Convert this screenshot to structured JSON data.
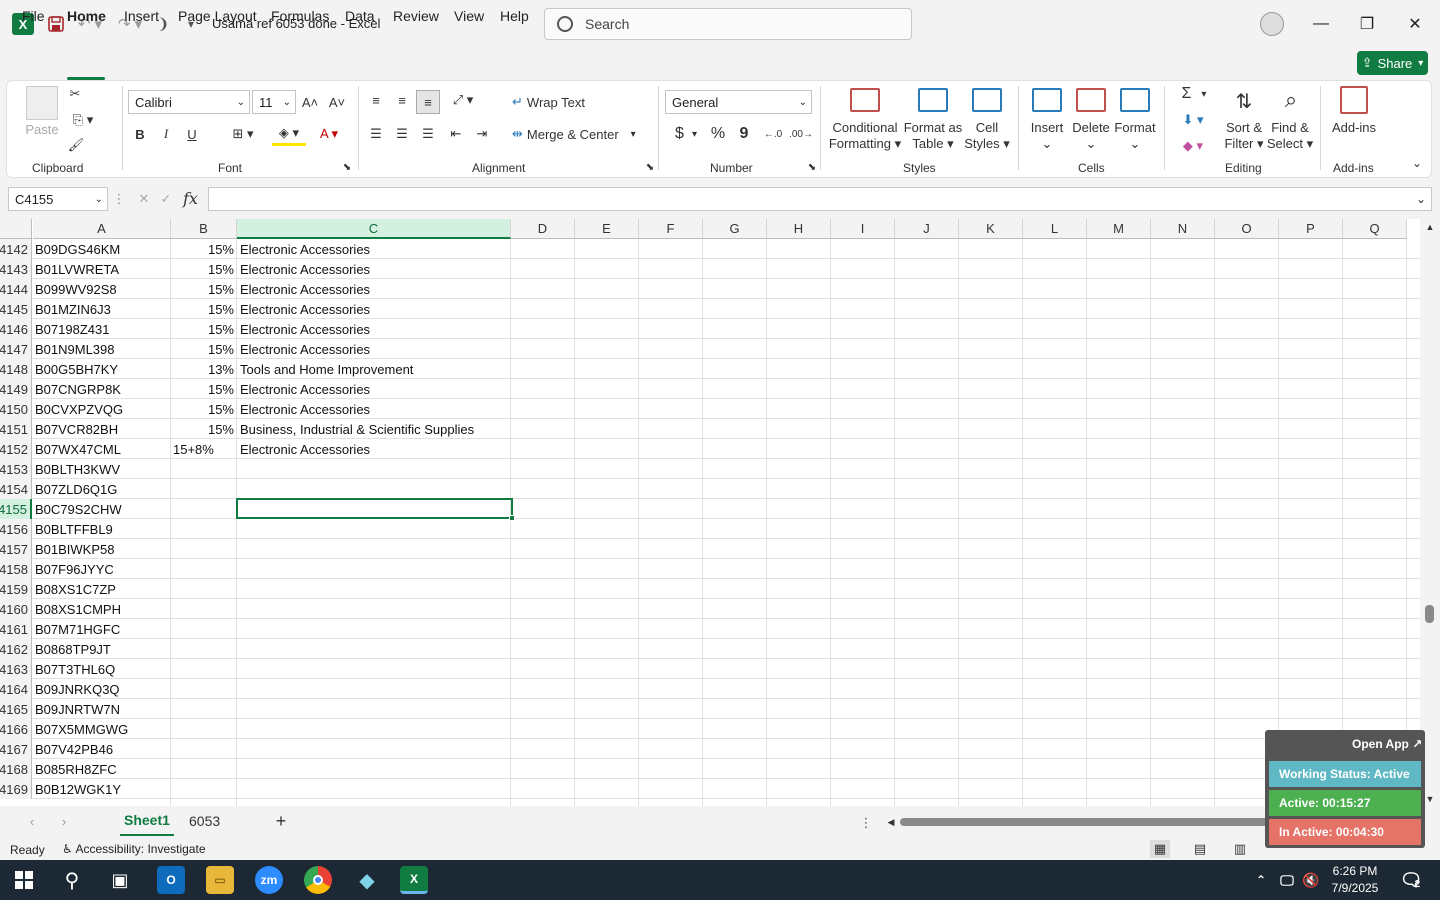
{
  "titlebar": {
    "doc_title": "Usama ref 6053 done  -  Excel",
    "search_placeholder": "Search"
  },
  "menu": [
    "File",
    "Home",
    "Insert",
    "Page Layout",
    "Formulas",
    "Data",
    "Review",
    "View",
    "Help"
  ],
  "share_label": "Share",
  "ribbon": {
    "paste_label": "Paste",
    "font_name": "Calibri",
    "font_size": "11",
    "wrap_text": "Wrap Text",
    "merge_center": "Merge & Center",
    "number_format": "General",
    "conditional_formatting": [
      "Conditional",
      "Formatting"
    ],
    "format_as_table": [
      "Format as",
      "Table"
    ],
    "cell_styles": [
      "Cell",
      "Styles"
    ],
    "insert": "Insert",
    "delete": "Delete",
    "format": "Format",
    "sort_filter": [
      "Sort &",
      "Filter"
    ],
    "find_select": [
      "Find &",
      "Select"
    ],
    "addins": "Add-ins",
    "groups": {
      "clipboard": "Clipboard",
      "font": "Font",
      "alignment": "Alignment",
      "number": "Number",
      "styles": "Styles",
      "cells": "Cells",
      "editing": "Editing",
      "addins": "Add-ins"
    },
    "bold": "B",
    "italic": "I",
    "underline": "U",
    "currency": "$",
    "percent": "%",
    "comma": "9",
    "sum": "Σ"
  },
  "formula_bar": {
    "name_box": "C4155",
    "fx": "fx",
    "content": ""
  },
  "columns": [
    "A",
    "B",
    "C",
    "D",
    "E",
    "F",
    "G",
    "H",
    "I",
    "J",
    "K",
    "L",
    "M",
    "N",
    "O",
    "P",
    "Q"
  ],
  "selected_column": "C",
  "rows": [
    {
      "num": "4142",
      "a": "B09DGS46KM",
      "b": "15%",
      "c": "Electronic Accessories"
    },
    {
      "num": "4143",
      "a": "B01LVWRETA",
      "b": "15%",
      "c": "Electronic Accessories"
    },
    {
      "num": "4144",
      "a": "B099WV92S8",
      "b": "15%",
      "c": "Electronic Accessories"
    },
    {
      "num": "4145",
      "a": "B01MZIN6J3",
      "b": "15%",
      "c": "Electronic Accessories"
    },
    {
      "num": "4146",
      "a": "B07198Z431",
      "b": "15%",
      "c": "Electronic Accessories"
    },
    {
      "num": "4147",
      "a": "B01N9ML398",
      "b": "15%",
      "c": "Electronic Accessories"
    },
    {
      "num": "4148",
      "a": "B00G5BH7KY",
      "b": "13%",
      "c": "Tools and Home Improvement"
    },
    {
      "num": "4149",
      "a": "B07CNGRP8K",
      "b": "15%",
      "c": "Electronic Accessories"
    },
    {
      "num": "4150",
      "a": "B0CVXPZVQG",
      "b": "15%",
      "c": "Electronic Accessories"
    },
    {
      "num": "4151",
      "a": "B07VCR82BH",
      "b": "15%",
      "c": "Business, Industrial & Scientific Supplies"
    },
    {
      "num": "4152",
      "a": "B07WX47CML",
      "b": "15+8%",
      "c": "Electronic Accessories"
    },
    {
      "num": "4153",
      "a": "B0BLTH3KWV",
      "b": "",
      "c": ""
    },
    {
      "num": "4154",
      "a": "B07ZLD6Q1G",
      "b": "",
      "c": ""
    },
    {
      "num": "4155",
      "a": "B0C79S2CHW",
      "b": "",
      "c": ""
    },
    {
      "num": "4156",
      "a": "B0BLTFFBL9",
      "b": "",
      "c": ""
    },
    {
      "num": "4157",
      "a": "B01BIWKP58",
      "b": "",
      "c": ""
    },
    {
      "num": "4158",
      "a": "B07F96JYYC",
      "b": "",
      "c": ""
    },
    {
      "num": "4159",
      "a": "B08XS1C7ZP",
      "b": "",
      "c": ""
    },
    {
      "num": "4160",
      "a": "B08XS1CMPH",
      "b": "",
      "c": ""
    },
    {
      "num": "4161",
      "a": "B07M71HGFC",
      "b": "",
      "c": ""
    },
    {
      "num": "4162",
      "a": "B0868TP9JT",
      "b": "",
      "c": ""
    },
    {
      "num": "4163",
      "a": "B07T3THL6Q",
      "b": "",
      "c": ""
    },
    {
      "num": "4164",
      "a": "B09JNRKQ3Q",
      "b": "",
      "c": ""
    },
    {
      "num": "4165",
      "a": "B09JNRTW7N",
      "b": "",
      "c": ""
    },
    {
      "num": "4166",
      "a": "B07X5MMGWG",
      "b": "",
      "c": ""
    },
    {
      "num": "4167",
      "a": "B07V42PB46",
      "b": "",
      "c": ""
    },
    {
      "num": "4168",
      "a": "B085RH8ZFC",
      "b": "",
      "c": ""
    },
    {
      "num": "4169",
      "a": "B0B12WGK1Y",
      "b": "",
      "c": ""
    }
  ],
  "selected_row": "4155",
  "sheets": [
    "Sheet1",
    "6053"
  ],
  "status": {
    "ready": "Ready",
    "accessibility": "Accessibility: Investigate"
  },
  "widget": {
    "open_app": "Open App ↗",
    "working_status": "Working Status: Active",
    "active": "Active: 00:15:27",
    "inactive": "In Active: 00:04:30",
    "colors": {
      "status": "#5fb8c4",
      "active": "#4caf50",
      "inactive": "#e57368"
    }
  },
  "clock": {
    "time": "6:26 PM",
    "date": "7/9/2025"
  },
  "notification_count": "2",
  "accent": "#107c41"
}
